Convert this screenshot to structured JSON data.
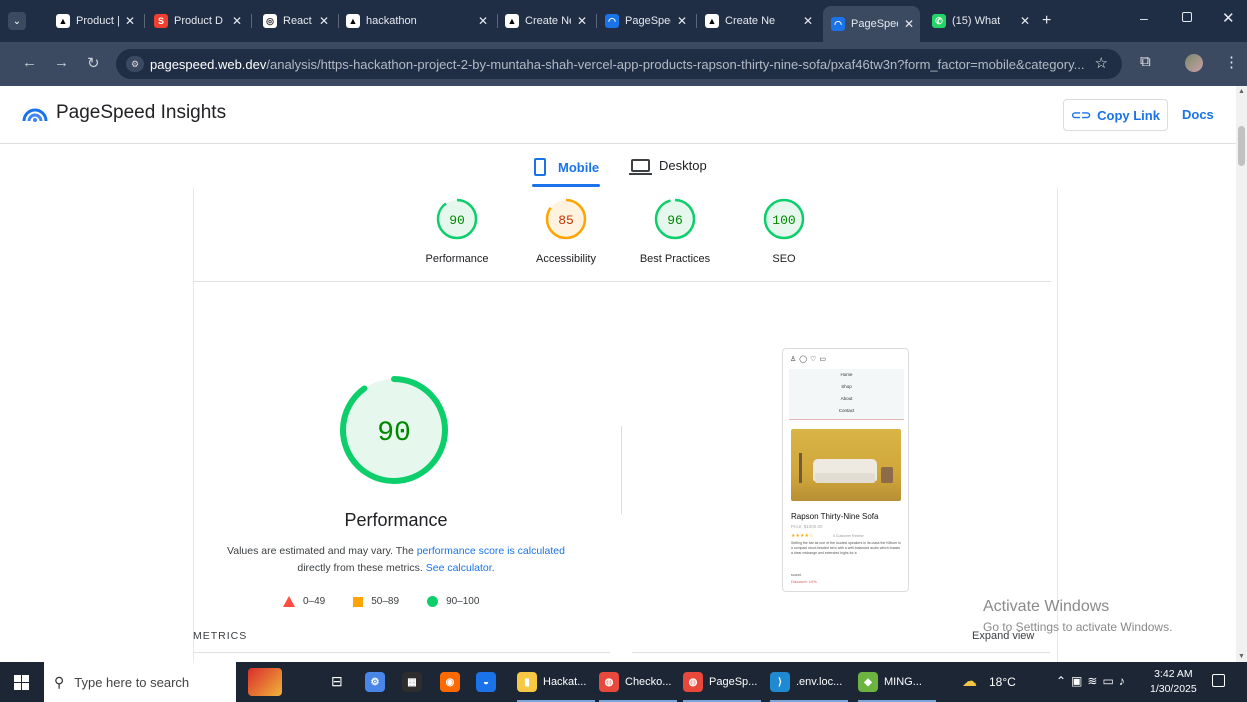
{
  "browser": {
    "tabs": [
      {
        "label": "Product |",
        "favicon": "vercel-triangle"
      },
      {
        "label": "Product D",
        "favicon": "sanity-s"
      },
      {
        "label": "React dep",
        "favicon": "chatgpt"
      },
      {
        "label": "hackathon",
        "favicon": "vercel-triangle"
      },
      {
        "label": "Create Ne",
        "favicon": "vercel-triangle"
      },
      {
        "label": "PageSpee",
        "favicon": "pagespeed"
      },
      {
        "label": "Create Ne",
        "favicon": "vercel-triangle"
      },
      {
        "label": "PageSpee",
        "favicon": "pagespeed"
      },
      {
        "label": "(15) What",
        "favicon": "whatsapp"
      }
    ],
    "active_tab": 7,
    "url_domain": "pagespeed.web.dev",
    "url_path": "/analysis/https-hackathon-project-2-by-muntaha-shah-vercel-app-products-rapson-thirty-nine-sofa/pxaf46tw3n?form_factor=mobile&category..."
  },
  "header": {
    "title": "PageSpeed Insights",
    "copy_link": "Copy Link",
    "docs": "Docs"
  },
  "device_tabs": {
    "mobile": "Mobile",
    "desktop": "Desktop",
    "selected": "mobile"
  },
  "scores": [
    {
      "value": "90",
      "label": "Performance",
      "status": "pass"
    },
    {
      "value": "85",
      "label": "Accessibility",
      "status": "average"
    },
    {
      "value": "96",
      "label": "Best Practices",
      "status": "pass"
    },
    {
      "value": "100",
      "label": "SEO",
      "status": "pass"
    }
  ],
  "performance": {
    "score": "90",
    "title": "Performance",
    "desc_before": "Values are estimated and may vary. The ",
    "desc_link1": "performance score is calculated",
    "desc_middle": " directly from these metrics. ",
    "desc_link2": "See calculator.",
    "legend": [
      {
        "range": "0–49",
        "shape": "triangle-icon"
      },
      {
        "range": "50–89",
        "shape": "square-icon"
      },
      {
        "range": "90–100",
        "shape": "circle-icon"
      }
    ]
  },
  "screenshot_preview": {
    "menu": [
      "Home",
      "Shop",
      "About",
      "Contact"
    ],
    "product_title": "Rapson Thirty-Nine Sofa",
    "price": "Price: $1000.00",
    "reviews": "5 Customer Review",
    "description": "Setting the bar as one of the loudest speakers in its class the Kilburn is a compact stout-hearted hero with a well-balanced audio which boasts a clear midrange and extended highs for a",
    "extra": "sound.",
    "discount": "Discount: 10%"
  },
  "sections": {
    "metrics": "METRICS",
    "expand": "Expand view"
  },
  "watermark": {
    "line1": "Activate Windows",
    "line2": "Go to Settings to activate Windows."
  },
  "taskbar": {
    "search_placeholder": "Type here to search",
    "apps": [
      "Hackat...",
      "Checko...",
      "PageSp...",
      ".env.loc...",
      "MING..."
    ],
    "weather": "18°C",
    "time": "3:42 AM",
    "date": "1/30/2025"
  },
  "colors": {
    "pass": "#0cce6b",
    "pass_text": "#008800",
    "average": "#ffa400",
    "average_text": "#c33300",
    "fail": "#ff4e42",
    "link": "#1a73e8"
  }
}
